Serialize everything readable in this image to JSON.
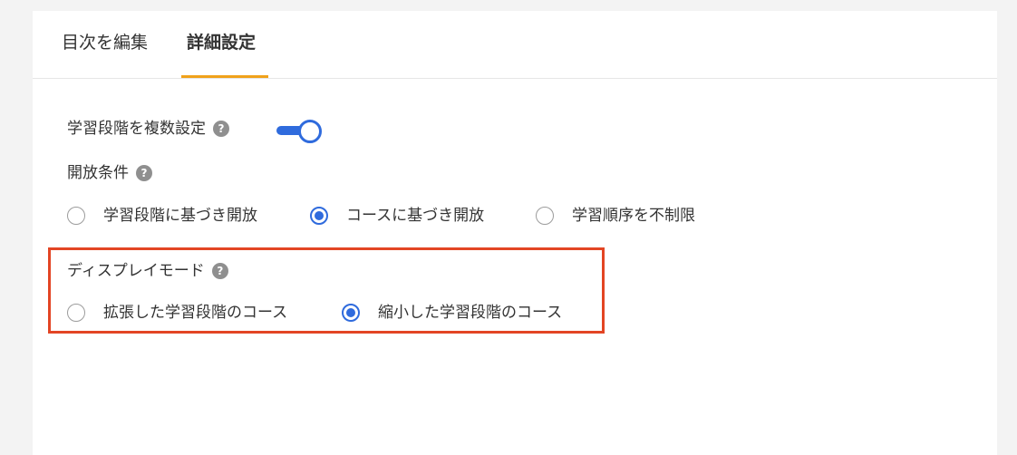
{
  "tabs": [
    {
      "label": "目次を編集",
      "active": false
    },
    {
      "label": "詳細設定",
      "active": true
    }
  ],
  "accent_color": "#f0a21b",
  "primary_color": "#2f6bdd",
  "highlight_color": "#e34524",
  "settings": {
    "multi_stage": {
      "label": "学習段階を複数設定",
      "help_icon": "?",
      "enabled": true
    },
    "open_condition": {
      "label": "開放条件",
      "help_icon": "?",
      "options": [
        {
          "label": "学習段階に基づき開放",
          "selected": false
        },
        {
          "label": "コースに基づき開放",
          "selected": true
        },
        {
          "label": "学習順序を不制限",
          "selected": false
        }
      ]
    },
    "display_mode": {
      "label": "ディスプレイモード",
      "help_icon": "?",
      "options": [
        {
          "label": "拡張した学習段階のコース",
          "selected": false
        },
        {
          "label": "縮小した学習段階のコース",
          "selected": true
        }
      ]
    }
  }
}
